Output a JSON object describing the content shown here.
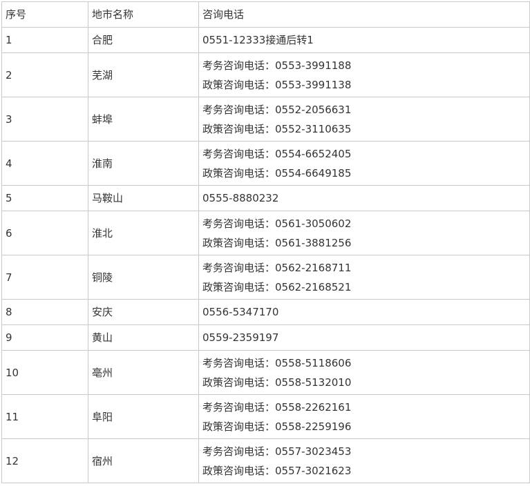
{
  "table": {
    "headers": [
      "序号",
      "地市名称",
      "咨询电话"
    ],
    "rows": [
      {
        "num": "1",
        "city": "合肥",
        "phones": [
          "0551-12333接通后转1"
        ]
      },
      {
        "num": "2",
        "city": "芜湖",
        "phones": [
          "考务咨询电话：0553-3991188",
          "政策咨询电话：0553-3991138"
        ]
      },
      {
        "num": "3",
        "city": "蚌埠",
        "phones": [
          "考务咨询电话：0552-2056631",
          "政策咨询电话：0552-3110635"
        ]
      },
      {
        "num": "4",
        "city": "淮南",
        "phones": [
          "考务咨询电话：0554-6652405",
          "政策咨询电话：0554-6649185"
        ]
      },
      {
        "num": "5",
        "city": "马鞍山",
        "phones": [
          "0555-8880232"
        ]
      },
      {
        "num": "6",
        "city": "淮北",
        "phones": [
          "考务咨询电话：0561-3050602",
          "政策咨询电话：0561-3881256"
        ]
      },
      {
        "num": "7",
        "city": "铜陵",
        "phones": [
          "考务咨询电话：0562-2168711",
          "政策咨询电话：0562-2168521"
        ]
      },
      {
        "num": "8",
        "city": "安庆",
        "phones": [
          "0556-5347170"
        ]
      },
      {
        "num": "9",
        "city": "黄山",
        "phones": [
          "0559-2359197"
        ]
      },
      {
        "num": "10",
        "city": "亳州",
        "phones": [
          "考务咨询电话：0558-5118606",
          "政策咨询电话：0558-5132010"
        ]
      },
      {
        "num": "11",
        "city": "阜阳",
        "phones": [
          "考务咨询电话：0558-2262161",
          "政策咨询电话：0558-2259196"
        ]
      },
      {
        "num": "12",
        "city": "宿州",
        "phones": [
          "考务咨询电话：0557-3023453",
          "政策咨询电话：0557-3021623"
        ]
      }
    ]
  }
}
